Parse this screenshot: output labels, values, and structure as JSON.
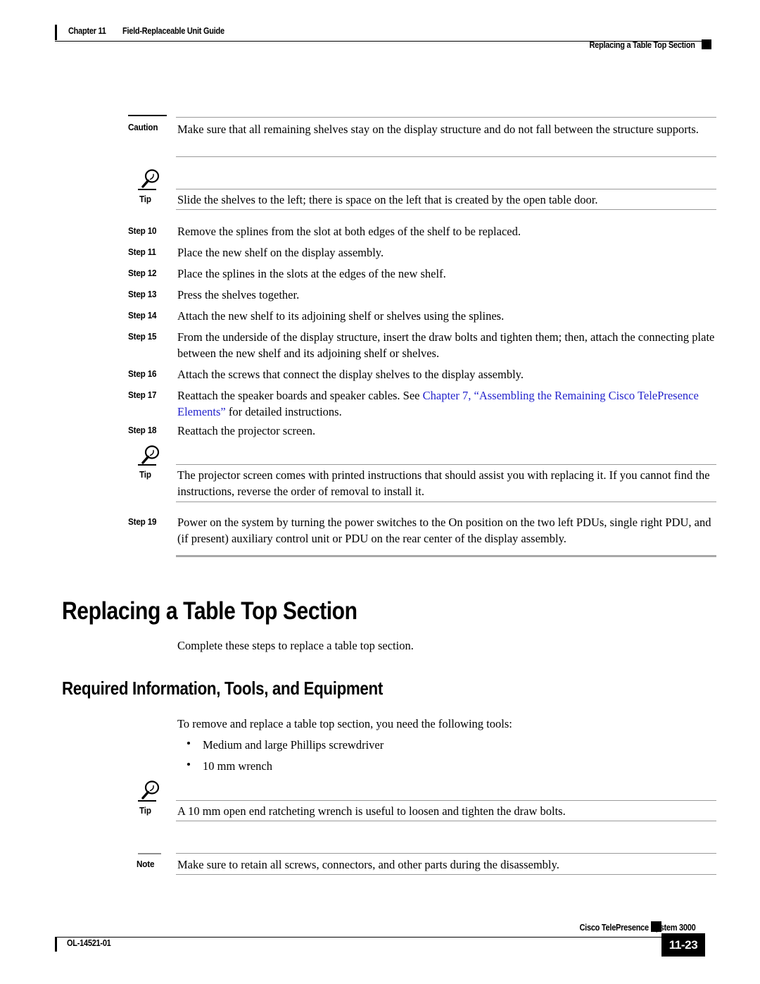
{
  "header": {
    "chapter": "Chapter 11",
    "guide_title": "Field-Replaceable Unit Guide",
    "section_title": "Replacing a Table Top Section"
  },
  "colors": {
    "link": "#2323cc",
    "rule": "#9a9a9a",
    "thick_rule": "#a8a8a8",
    "text": "#000000"
  },
  "blocks": {
    "caution_1": {
      "label": "Caution",
      "text": "Make sure that all remaining shelves stay on the display structure and do not fall between the structure supports."
    },
    "tip_1": {
      "label": "Tip",
      "icon": "lightbulb-icon",
      "text": "Slide the shelves to the left; there is space on the left that is created by the open table door."
    },
    "tip_2": {
      "label": "Tip",
      "icon": "lightbulb-icon",
      "text": "The projector screen comes with printed instructions that should assist you with replacing it. If you cannot find the instructions, reverse the order of removal to install it."
    },
    "tip_3": {
      "label": "Tip",
      "icon": "lightbulb-icon",
      "text": "A 10 mm open end ratcheting wrench is useful to loosen and tighten the draw bolts."
    },
    "note_1": {
      "label": "Note",
      "text": "Make sure to retain all screws, connectors, and other parts during the disassembly."
    }
  },
  "steps": [
    {
      "label": "Step 10",
      "text": "Remove the splines from the slot at both edges of the shelf to be replaced."
    },
    {
      "label": "Step 11",
      "text": "Place the new shelf on the display assembly."
    },
    {
      "label": "Step 12",
      "text": "Place the splines in the slots at the edges of the new shelf."
    },
    {
      "label": "Step 13",
      "text": "Press the shelves together."
    },
    {
      "label": "Step 14",
      "text": "Attach the new shelf to its adjoining shelf or shelves using the splines."
    },
    {
      "label": "Step 15",
      "text": "From the underside of the display structure, insert the draw bolts and tighten them; then, attach the connecting plate between the new shelf and its adjoining shelf or shelves."
    },
    {
      "label": "Step 16",
      "text": "Attach the screws that connect the display shelves to the display assembly."
    },
    {
      "label": "Step 17",
      "text_before": "Reattach the speaker boards and speaker cables. See ",
      "link_text": "Chapter 7, “Assembling the Remaining Cisco TelePresence Elements”",
      "text_after": " for detailed instructions."
    },
    {
      "label": "Step 18",
      "text": "Reattach the projector screen."
    },
    {
      "label": "Step 19",
      "text": "Power on the system by turning the power switches to the On position on the two left PDUs, single right PDU, and (if present) auxiliary control unit or PDU on the rear center of the display assembly."
    }
  ],
  "headings": {
    "h1": "Replacing a Table Top Section",
    "h1_intro": "Complete these steps to replace a table top section.",
    "h2": "Required Information, Tools, and Equipment"
  },
  "tools_section": {
    "intro": "To remove and replace a table top section, you need the following tools:",
    "bullets": [
      "Medium and large Phillips screwdriver",
      "10 mm wrench"
    ]
  },
  "footer": {
    "doc_id": "OL-14521-01",
    "product": "Cisco TelePresence System 3000",
    "page_number": "11-23"
  }
}
